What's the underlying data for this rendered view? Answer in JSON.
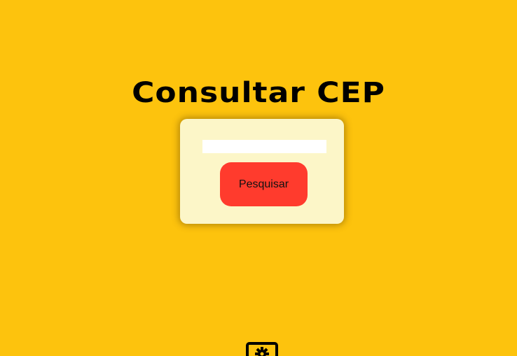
{
  "page": {
    "title": "Consultar CEP",
    "background_color": "#fdc30d"
  },
  "form": {
    "cep_input_value": "",
    "cep_input_placeholder": "",
    "search_button_label": "Pesquisar",
    "button_color": "#ff3b2d",
    "card_color": "#fcf6c8"
  },
  "footer": {
    "icon": "gear-icon"
  }
}
